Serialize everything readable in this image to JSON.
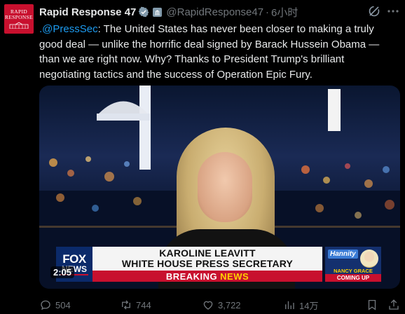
{
  "tweet": {
    "author": {
      "name": "Rapid Response 47",
      "handle": "@RapidResponse47",
      "avatar_text": [
        "RAPID",
        "RESPONSE"
      ]
    },
    "separator": "·",
    "time": "6小时",
    "text_mention": ".@PressSec",
    "text_body": ": The United States has never been closer to making a truly good deal — unlike the horrific deal signed by Barack Hussein Obama — than we are right now. Why? Thanks to President Trump's brilliant negotiating tactics and the success of Operation Epic Fury."
  },
  "video": {
    "timestamp": "2:05",
    "network_logo": {
      "line1": "FOX",
      "line2": "NEWS"
    },
    "lower_third": {
      "name": "KAROLINE LEAVITT",
      "title": "WHITE HOUSE PRESS SECRETARY",
      "breaking_word1": "BREAKING",
      "breaking_word2": "NEWS"
    },
    "promo": {
      "show": "Hannity",
      "host": "NANCY GRACE",
      "tag": "COMING UP"
    }
  },
  "actions": {
    "replies": "504",
    "reposts": "744",
    "likes": "3,722",
    "views": "14万"
  },
  "colors": {
    "background": "#000000",
    "text": "#e7e9ea",
    "muted": "#71767b",
    "accent": "#1d9bf0",
    "fox_red": "#c8102e",
    "fox_blue": "#0b2a6a"
  },
  "icons": {
    "verified": "verified-badge-icon",
    "affiliation": "government-affiliation-icon",
    "grok": "grok-icon",
    "more": "more-icon",
    "reply": "reply-icon",
    "repost": "repost-icon",
    "like": "like-icon",
    "views": "views-icon",
    "bookmark": "bookmark-icon",
    "share": "share-icon"
  }
}
